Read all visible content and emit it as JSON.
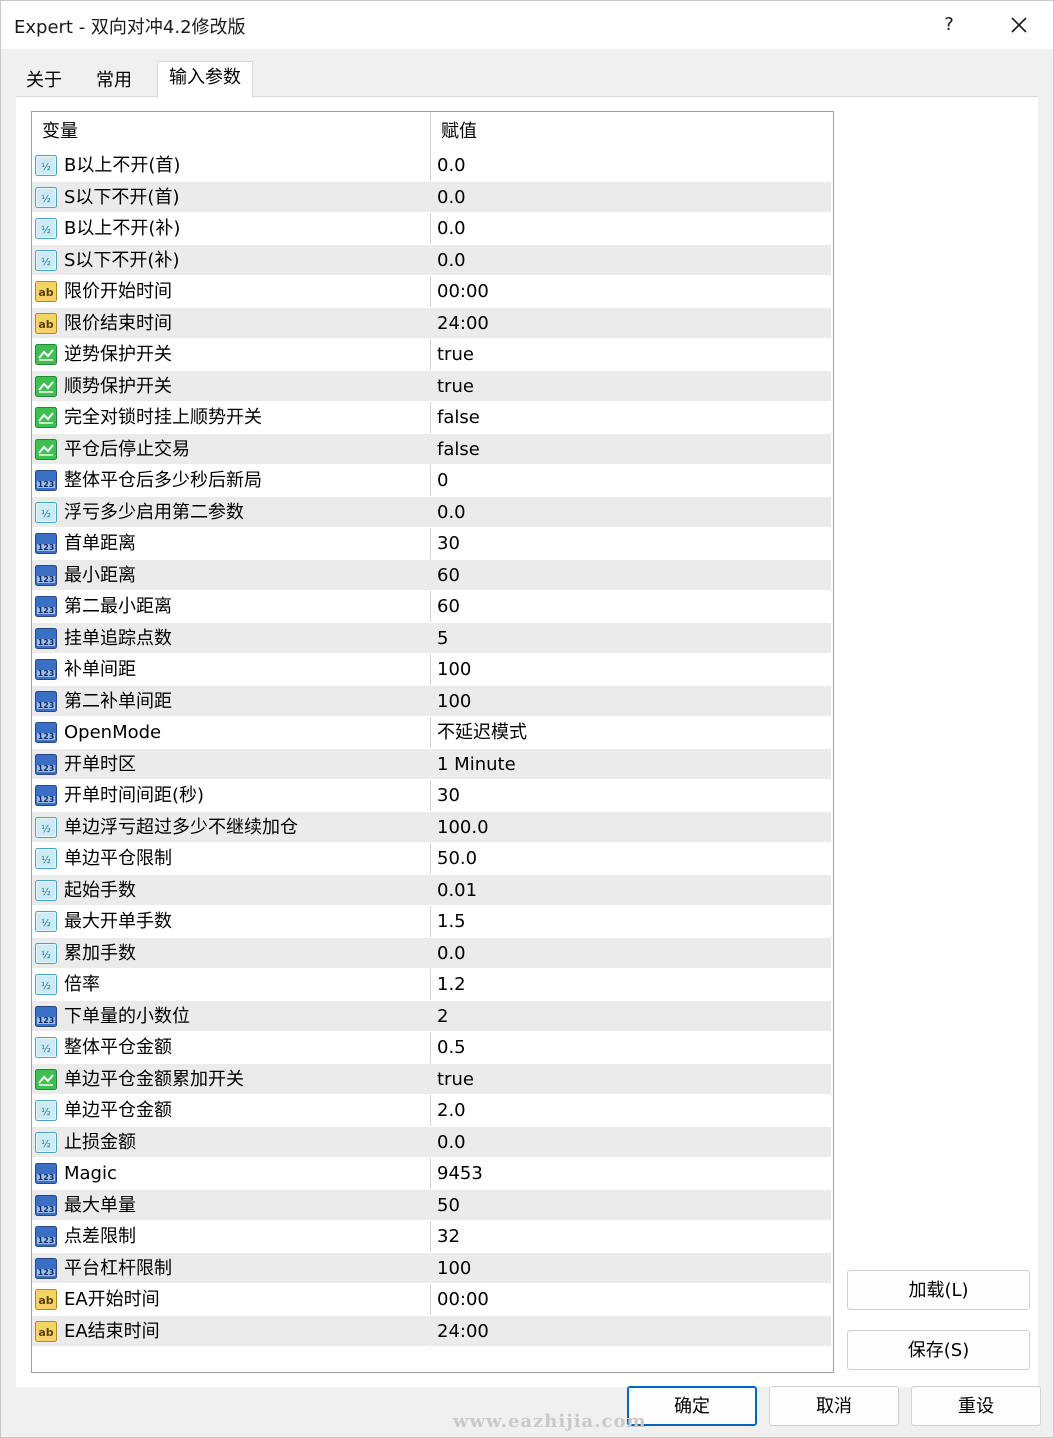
{
  "window": {
    "title": "Expert - 双向对冲4.2修改版",
    "help_label": "?"
  },
  "tabs": [
    {
      "label": "关于"
    },
    {
      "label": "常用"
    },
    {
      "label": "输入参数",
      "active": true
    }
  ],
  "grid": {
    "col_variable": "变量",
    "col_value": "赋值",
    "rows": [
      {
        "type": "double",
        "name": "B以上不开(首)",
        "value": "0.0"
      },
      {
        "type": "double",
        "name": "S以下不开(首)",
        "value": "0.0"
      },
      {
        "type": "double",
        "name": "B以上不开(补)",
        "value": "0.0"
      },
      {
        "type": "double",
        "name": "S以下不开(补)",
        "value": "0.0"
      },
      {
        "type": "string",
        "name": "限价开始时间",
        "value": "00:00"
      },
      {
        "type": "string",
        "name": "限价结束时间",
        "value": "24:00"
      },
      {
        "type": "bool",
        "name": "逆势保护开关",
        "value": "true"
      },
      {
        "type": "bool",
        "name": "顺势保护开关",
        "value": "true"
      },
      {
        "type": "bool",
        "name": "完全对锁时挂上顺势开关",
        "value": "false"
      },
      {
        "type": "bool",
        "name": "平仓后停止交易",
        "value": "false"
      },
      {
        "type": "int",
        "name": "整体平仓后多少秒后新局",
        "value": "0"
      },
      {
        "type": "double",
        "name": "浮亏多少启用第二参数",
        "value": "0.0"
      },
      {
        "type": "int",
        "name": "首单距离",
        "value": "30"
      },
      {
        "type": "int",
        "name": "最小距离",
        "value": "60"
      },
      {
        "type": "int",
        "name": "第二最小距离",
        "value": "60"
      },
      {
        "type": "int",
        "name": "挂单追踪点数",
        "value": "5"
      },
      {
        "type": "int",
        "name": "补单间距",
        "value": "100"
      },
      {
        "type": "int",
        "name": "第二补单间距",
        "value": "100"
      },
      {
        "type": "int",
        "name": "OpenMode",
        "value": "不延迟模式"
      },
      {
        "type": "int",
        "name": "开单时区",
        "value": "1 Minute"
      },
      {
        "type": "int",
        "name": "开单时间间距(秒)",
        "value": "30"
      },
      {
        "type": "double",
        "name": "单边浮亏超过多少不继续加仓",
        "value": "100.0"
      },
      {
        "type": "double",
        "name": "单边平仓限制",
        "value": "50.0"
      },
      {
        "type": "double",
        "name": "起始手数",
        "value": "0.01"
      },
      {
        "type": "double",
        "name": "最大开单手数",
        "value": "1.5"
      },
      {
        "type": "double",
        "name": "累加手数",
        "value": "0.0"
      },
      {
        "type": "double",
        "name": "倍率",
        "value": "1.2"
      },
      {
        "type": "int",
        "name": "下单量的小数位",
        "value": "2"
      },
      {
        "type": "double",
        "name": "整体平仓金额",
        "value": "0.5"
      },
      {
        "type": "bool",
        "name": "单边平仓金额累加开关",
        "value": "true"
      },
      {
        "type": "double",
        "name": "单边平仓金额",
        "value": "2.0"
      },
      {
        "type": "double",
        "name": "止损金额",
        "value": "0.0"
      },
      {
        "type": "int",
        "name": "Magic",
        "value": "9453"
      },
      {
        "type": "int",
        "name": "最大单量",
        "value": "50"
      },
      {
        "type": "int",
        "name": "点差限制",
        "value": "32"
      },
      {
        "type": "int",
        "name": "平台杠杆限制",
        "value": "100"
      },
      {
        "type": "string",
        "name": "EA开始时间",
        "value": "00:00"
      },
      {
        "type": "string",
        "name": "EA结束时间",
        "value": "24:00"
      }
    ]
  },
  "side_buttons": {
    "load_label": "加载(L)",
    "save_label": "保存(S)"
  },
  "footer_buttons": {
    "ok_label": "确定",
    "cancel_label": "取消",
    "reset_label": "重设"
  },
  "watermark": "www.eazhijia.com",
  "icons": {
    "double": "decimal-half-icon",
    "string": "text-ab-icon",
    "bool": "boolean-toggle-icon",
    "int": "integer-123-icon"
  },
  "colors": {
    "row_alt": "#ebebeb",
    "primary_border": "#0067c0"
  }
}
